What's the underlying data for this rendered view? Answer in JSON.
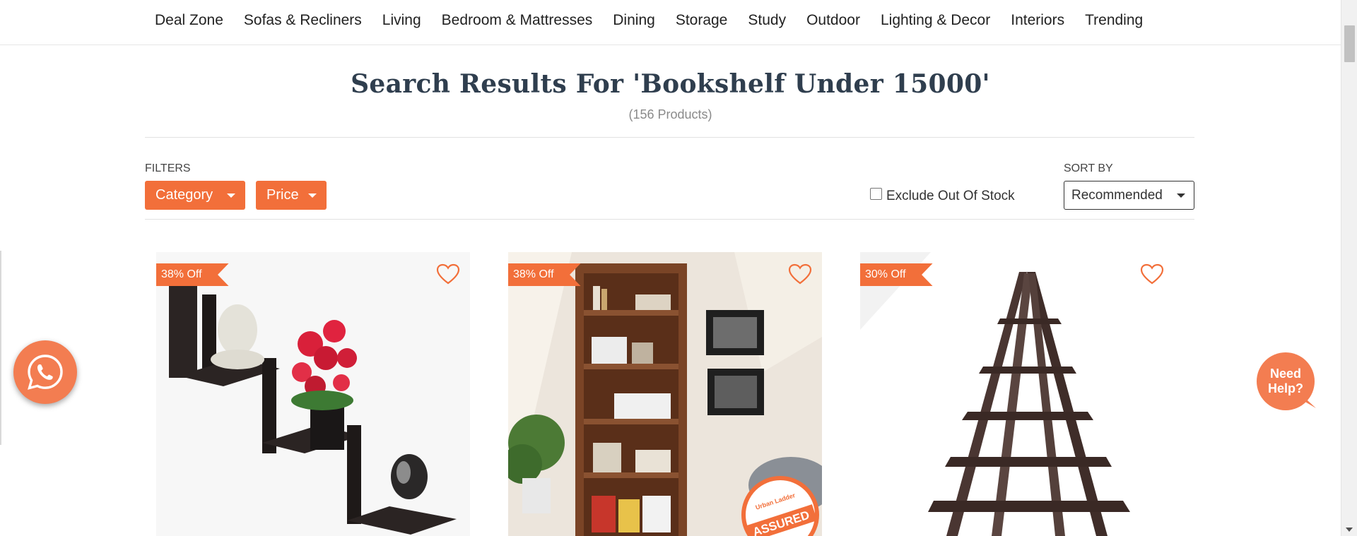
{
  "nav": {
    "items": [
      "Deal Zone",
      "Sofas & Recliners",
      "Living",
      "Bedroom & Mattresses",
      "Dining",
      "Storage",
      "Study",
      "Outdoor",
      "Lighting & Decor",
      "Interiors",
      "Trending"
    ]
  },
  "results": {
    "title": "Search Results For 'Bookshelf Under 15000'",
    "count": "(156 Products)"
  },
  "filters": {
    "label": "FILTERS",
    "category_label": "Category",
    "price_label": "Price",
    "exclude_label": "Exclude Out Of Stock",
    "exclude_checked": false
  },
  "sort": {
    "label": "SORT BY",
    "selected": "Recommended"
  },
  "products": [
    {
      "discount": "38% Off",
      "image": "wall-shelf-photo",
      "wishlisted": false
    },
    {
      "discount": "38% Off",
      "image": "bookshelf-room-photo",
      "wishlisted": false,
      "stamp": "ASSURED",
      "stamp_top": "Urban Ladder"
    },
    {
      "discount": "30% Off",
      "image": "ladder-shelf-photo",
      "wishlisted": false
    }
  ],
  "help": {
    "line1": "Need",
    "line2": "Help?"
  },
  "icons": {
    "wishlist": "heart-outline-icon",
    "chat": "whatsapp-icon"
  },
  "colors": {
    "accent": "#f26f3a",
    "title": "#2f3e4e",
    "widget": "#f37d51"
  }
}
